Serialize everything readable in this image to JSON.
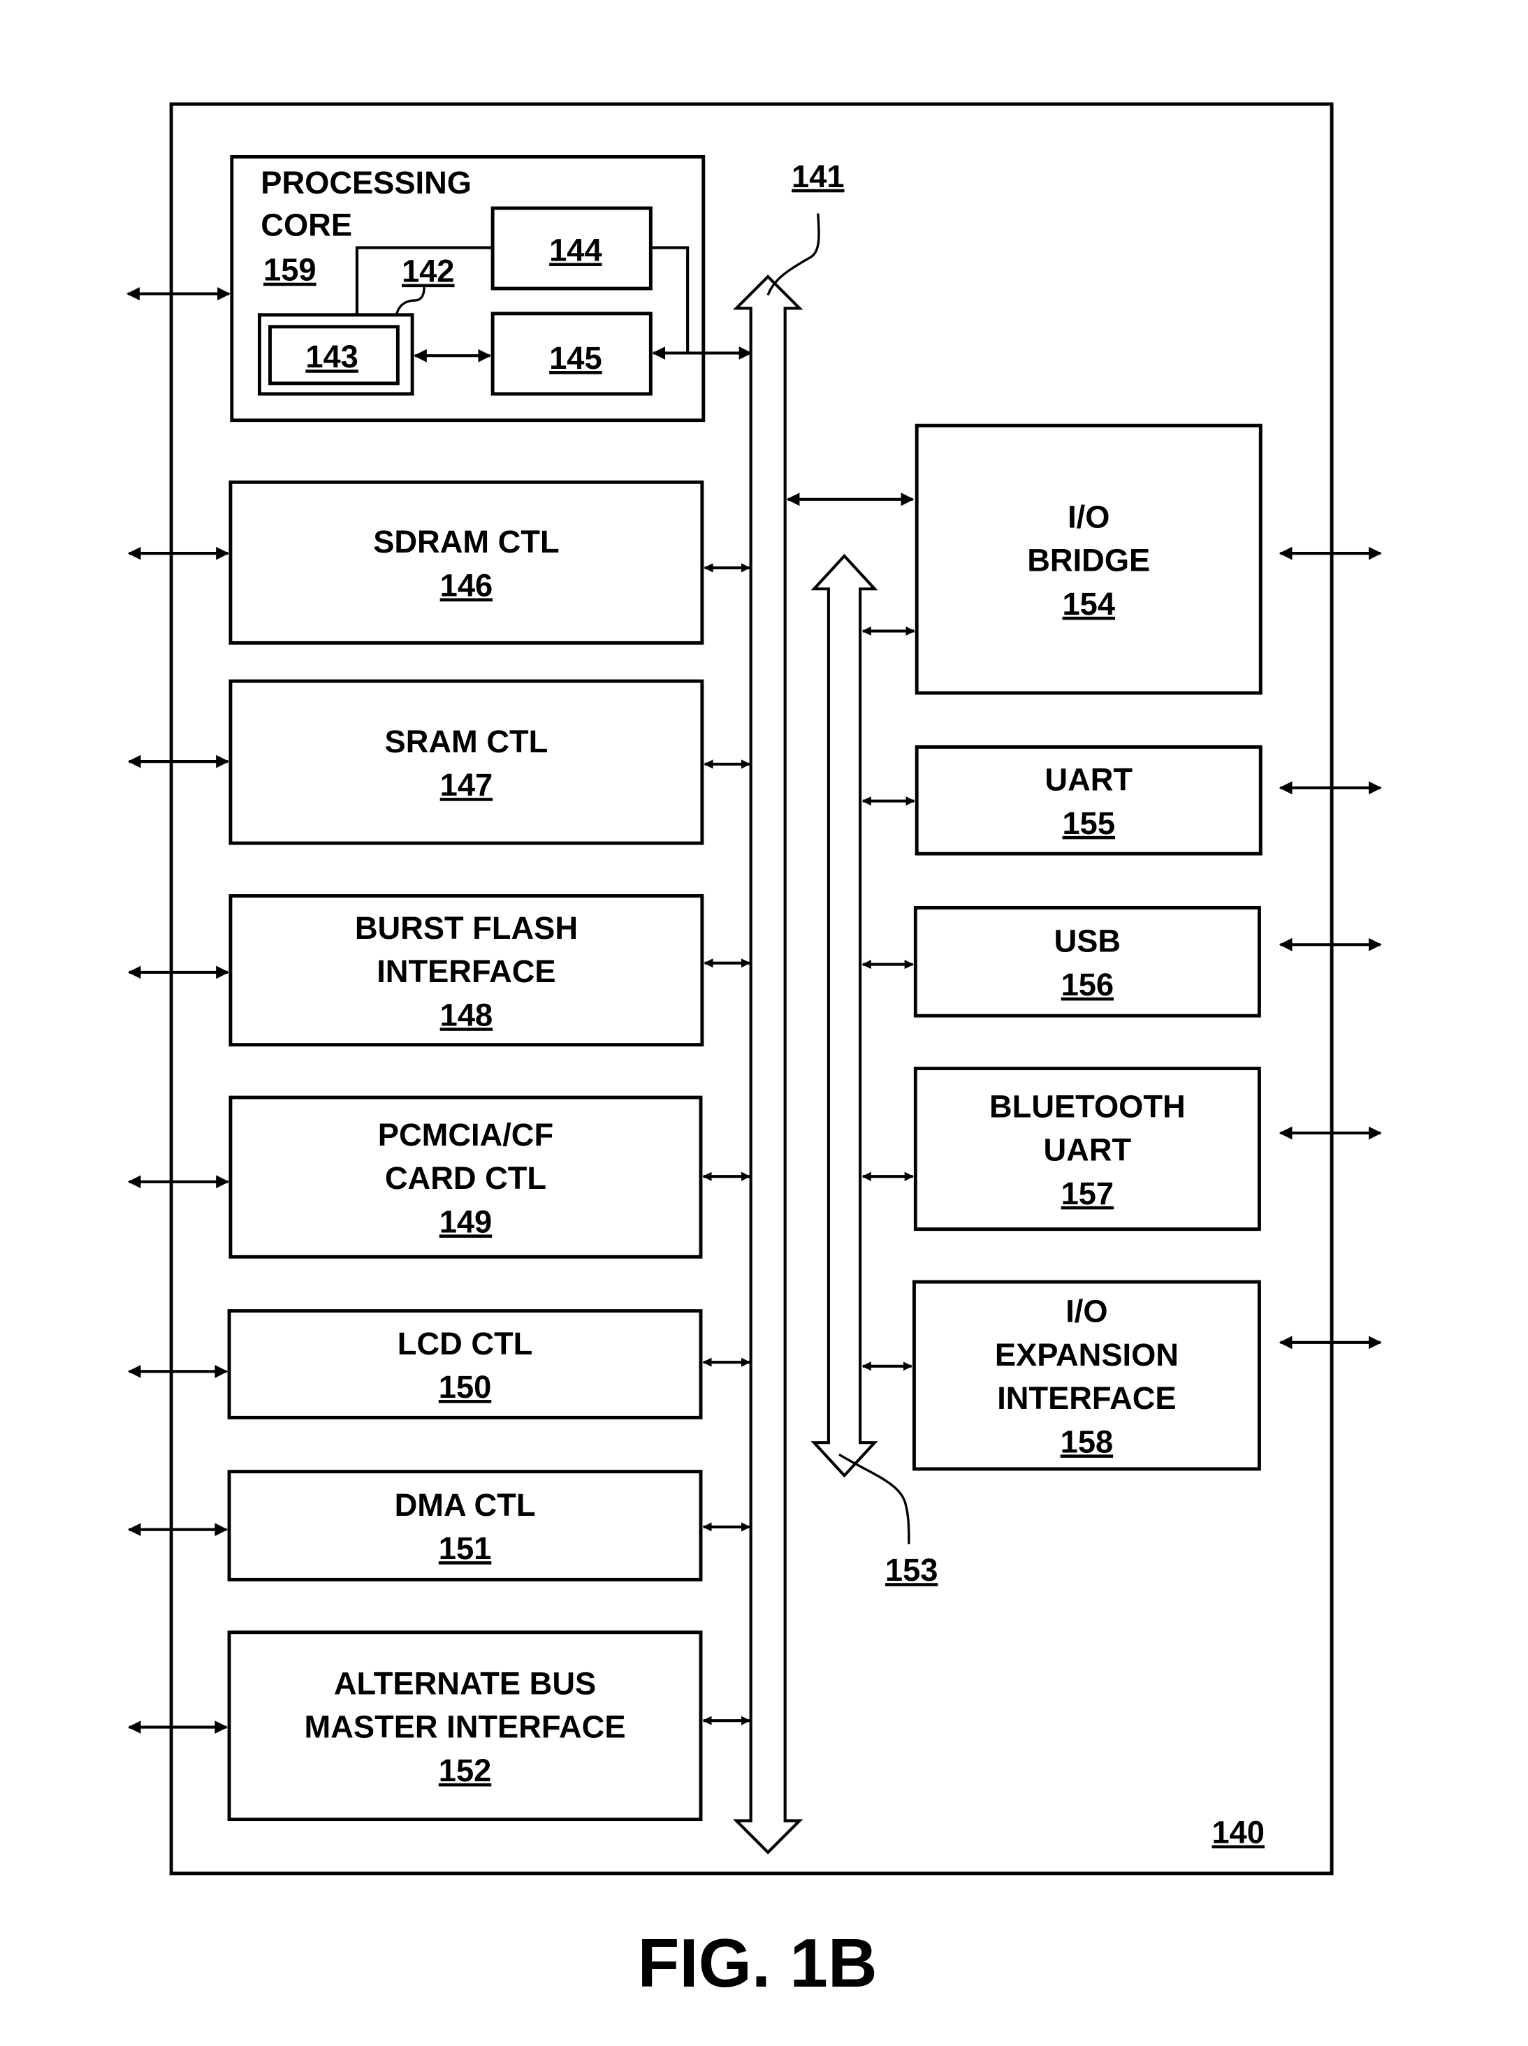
{
  "figure": {
    "caption": "FIG. 1B",
    "system_ref": "140",
    "bus_main_ref": "141",
    "bus_io_ref": "153",
    "colors": {
      "ink": "#000000",
      "paper": "#ffffff"
    }
  },
  "processing_core": {
    "title_line1": "PROCESSING",
    "title_line2": "CORE",
    "ref": "159",
    "inner": {
      "block_142_ref": "142",
      "block_143_ref": "143",
      "block_144_ref": "144",
      "block_145_ref": "145"
    }
  },
  "left_blocks": [
    {
      "lines": [
        "SDRAM CTL"
      ],
      "ref": "146"
    },
    {
      "lines": [
        "SRAM CTL"
      ],
      "ref": "147"
    },
    {
      "lines": [
        "BURST FLASH",
        "INTERFACE"
      ],
      "ref": "148"
    },
    {
      "lines": [
        "PCMCIA/CF",
        "CARD CTL"
      ],
      "ref": "149"
    },
    {
      "lines": [
        "LCD CTL"
      ],
      "ref": "150"
    },
    {
      "lines": [
        "DMA CTL"
      ],
      "ref": "151"
    },
    {
      "lines": [
        "ALTERNATE BUS",
        "MASTER INTERFACE"
      ],
      "ref": "152"
    }
  ],
  "right_blocks": [
    {
      "lines": [
        "I/O",
        "BRIDGE"
      ],
      "ref": "154"
    },
    {
      "lines": [
        "UART"
      ],
      "ref": "155"
    },
    {
      "lines": [
        "USB"
      ],
      "ref": "156"
    },
    {
      "lines": [
        "BLUETOOTH",
        "UART"
      ],
      "ref": "157"
    },
    {
      "lines": [
        "I/O",
        "EXPANSION",
        "INTERFACE"
      ],
      "ref": "158"
    }
  ]
}
